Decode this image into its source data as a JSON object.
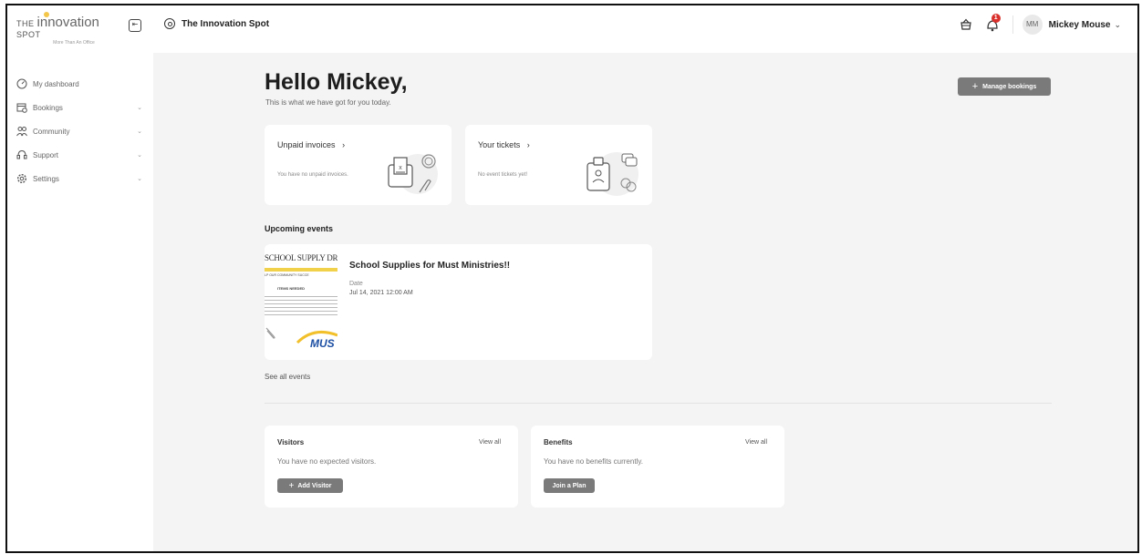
{
  "header": {
    "logo": {
      "prefix": "THE",
      "main": "innovation",
      "suffix": "SPOT",
      "tagline": "More Than An Office"
    },
    "location": "The Innovation Spot",
    "notification_count": "1",
    "user": {
      "initials": "MM",
      "name": "Mickey Mouse"
    }
  },
  "sidebar": {
    "items": [
      {
        "label": "My dashboard",
        "icon": "gauge-icon"
      },
      {
        "label": "Bookings",
        "icon": "calendar-icon"
      },
      {
        "label": "Community",
        "icon": "people-icon"
      },
      {
        "label": "Support",
        "icon": "headset-icon"
      },
      {
        "label": "Settings",
        "icon": "gear-icon"
      }
    ]
  },
  "main": {
    "greeting": "Hello Mickey,",
    "subtitle": "This is what we have got for you today.",
    "manage_bookings": "Manage bookings",
    "invoices": {
      "title": "Unpaid invoices",
      "empty": "You have no unpaid invoices."
    },
    "tickets": {
      "title": "Your tickets",
      "empty": "No event tickets yet!"
    },
    "upcoming_events_label": "Upcoming events",
    "event": {
      "poster_title": "SCHOOL SUPPLY DRIV",
      "poster_sub": "LP OUR COMMUNITY SUCCE",
      "poster_items": "ITEMS NEEDED",
      "poster_logo": "MUS",
      "title": "School Supplies for Must Ministries!!",
      "date_label": "Date",
      "date": "Jul 14, 2021 12:00 AM"
    },
    "see_all_events": "See all events",
    "visitors": {
      "title": "Visitors",
      "view_all": "View all",
      "empty": "You have no expected visitors.",
      "button": "Add Visitor"
    },
    "benefits": {
      "title": "Benefits",
      "view_all": "View all",
      "empty": "You have no benefits currently.",
      "button": "Join a Plan"
    }
  }
}
